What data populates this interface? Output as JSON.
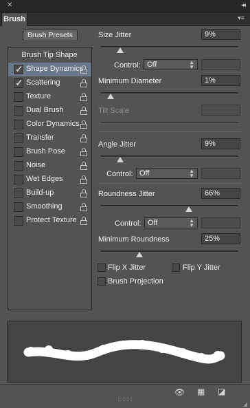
{
  "window": {
    "close_glyph": "✕",
    "collapse_glyph": "◂◂",
    "menu_glyph": "▾≡"
  },
  "tab": {
    "label": "Brush"
  },
  "brush_presets_button": "Brush Presets",
  "tip_list": {
    "header": "Brush Tip Shape",
    "items": [
      {
        "label": "Shape Dynamics",
        "checked": true,
        "selected": true
      },
      {
        "label": "Scattering",
        "checked": true,
        "selected": false
      },
      {
        "label": "Texture",
        "checked": false,
        "selected": false
      },
      {
        "label": "Dual Brush",
        "checked": false,
        "selected": false
      },
      {
        "label": "Color Dynamics",
        "checked": false,
        "selected": false
      },
      {
        "label": "Transfer",
        "checked": false,
        "selected": false
      },
      {
        "label": "Brush Pose",
        "checked": false,
        "selected": false
      },
      {
        "label": "Noise",
        "checked": false,
        "selected": false
      },
      {
        "label": "Wet Edges",
        "checked": false,
        "selected": false
      },
      {
        "label": "Build-up",
        "checked": false,
        "selected": false
      },
      {
        "label": "Smoothing",
        "checked": false,
        "selected": false
      },
      {
        "label": "Protect Texture",
        "checked": false,
        "selected": false
      }
    ]
  },
  "settings": {
    "size_jitter": {
      "label": "Size Jitter",
      "value": "9%",
      "level": 0.09
    },
    "size_control": {
      "label": "Control:",
      "value": "Off"
    },
    "minimum_diameter": {
      "label": "Minimum Diameter",
      "value": "1%",
      "level": 0.01
    },
    "tilt_scale": {
      "label": "Tilt Scale",
      "value": ""
    },
    "angle_jitter": {
      "label": "Angle Jitter",
      "value": "9%",
      "level": 0.09
    },
    "angle_control": {
      "label": "Control:",
      "value": "Off"
    },
    "roundness_jitter": {
      "label": "Roundness Jitter",
      "value": "66%",
      "level": 0.66
    },
    "roundness_control": {
      "label": "Control:",
      "value": "Off"
    },
    "minimum_roundness": {
      "label": "Minimum Roundness",
      "value": "25%",
      "level": 0.25
    },
    "flip_x": {
      "label": "Flip X Jitter",
      "checked": false
    },
    "flip_y": {
      "label": "Flip Y Jitter",
      "checked": false
    },
    "brush_projection": {
      "label": "Brush Projection",
      "checked": false
    }
  },
  "icons": {
    "lock": "lock-icon",
    "toggle_preview": "eye-brush-icon",
    "grid": "grid-icon",
    "new_preset": "new-page-icon"
  },
  "colors": {
    "panel": "#535353",
    "selected_row": "#6a7889",
    "stroke": "#ffffff"
  }
}
